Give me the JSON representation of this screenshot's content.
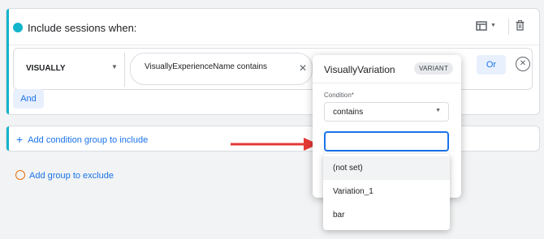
{
  "group": {
    "title": "Include sessions when:",
    "dimension": "VISUALLY",
    "condition_chip": "VisuallyExperienceName contains",
    "or_label": "Or",
    "and_label": "And"
  },
  "add_condition_group": "Add condition group to include",
  "add_group_exclude": "Add group to exclude",
  "popover": {
    "title": "VisuallyVariation",
    "badge": "VARIANT",
    "condition_label": "Condition*",
    "condition_value": "contains",
    "input_value": ""
  },
  "dropdown_items": [
    "(not set)",
    "Variation_1",
    "bar"
  ],
  "colors": {
    "accent_teal": "#12b5cb",
    "link_blue": "#1a73e8",
    "exclude_orange": "#e8710a",
    "arrow_red": "#e53935"
  },
  "icons": [
    "card-layout-icon",
    "chevron-down-icon",
    "trash-icon",
    "close-icon",
    "remove-circle-icon",
    "plus-icon",
    "caret-down-icon",
    "red-arrow"
  ]
}
